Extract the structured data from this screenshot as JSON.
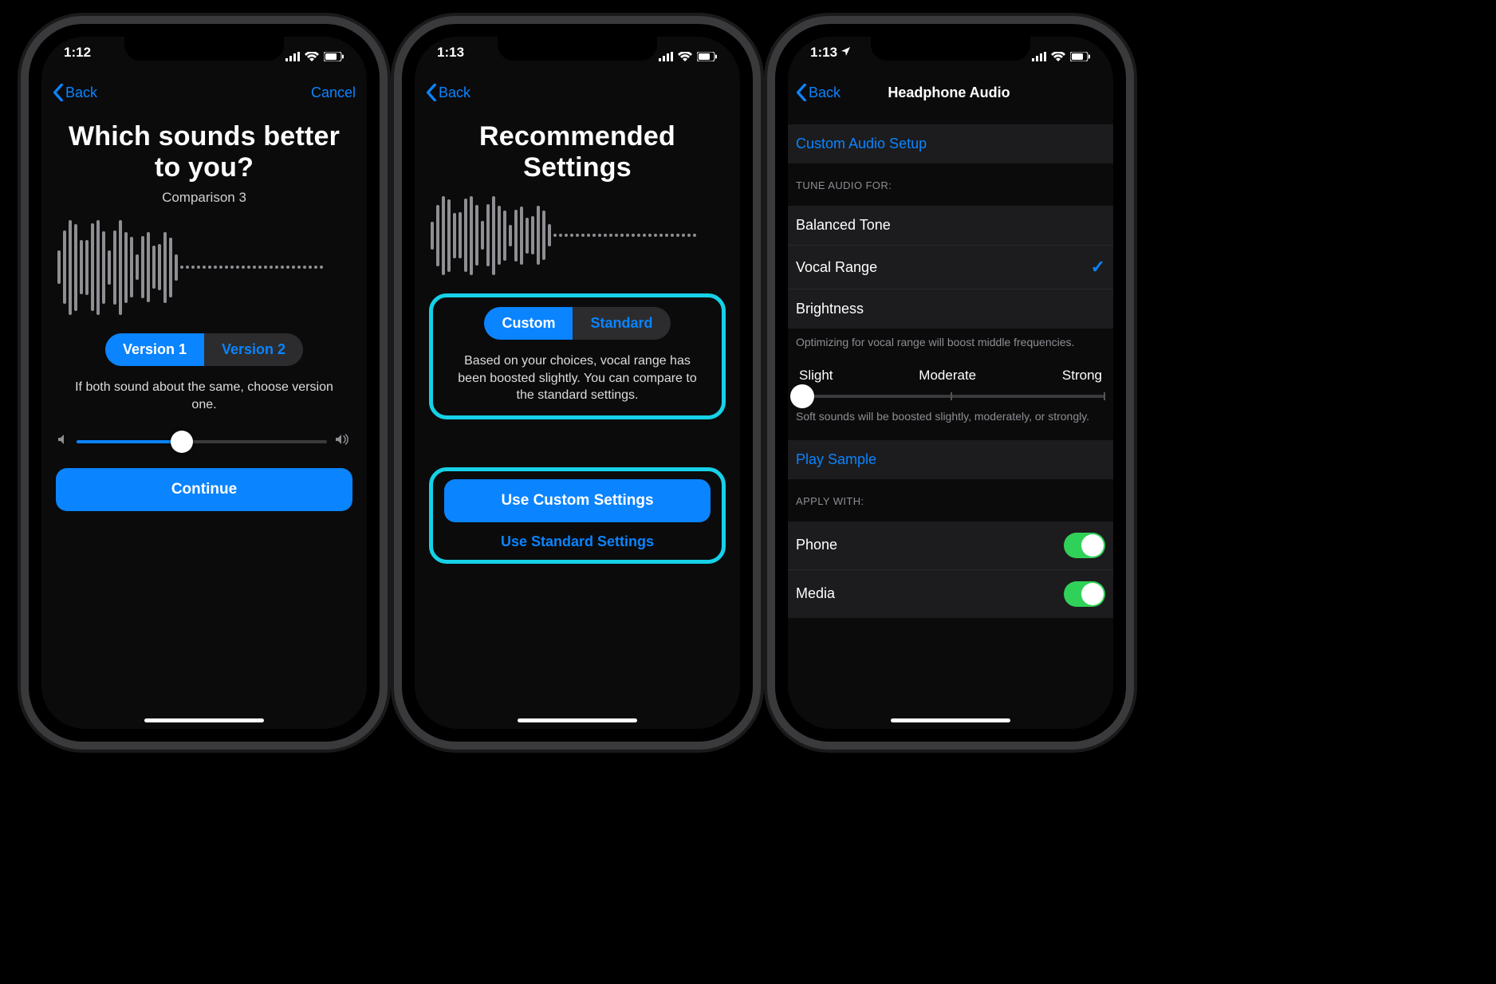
{
  "status": {
    "time1": "1:12",
    "time2": "1:13",
    "time3": "1:13"
  },
  "phone1": {
    "back": "Back",
    "cancel": "Cancel",
    "title": "Which sounds better to you?",
    "subtitle": "Comparison 3",
    "segments": {
      "a": "Version 1",
      "b": "Version 2",
      "selected": "a"
    },
    "instruction": "If both sound about the same, choose version one.",
    "volume_percent": 42,
    "continue": "Continue"
  },
  "phone2": {
    "back": "Back",
    "title": "Recommended Settings",
    "segments": {
      "a": "Custom",
      "b": "Standard",
      "selected": "a"
    },
    "description": "Based on your choices, vocal range has been boosted slightly. You can compare to the standard settings.",
    "primary": "Use Custom Settings",
    "secondary": "Use Standard Settings"
  },
  "phone3": {
    "back": "Back",
    "title": "Headphone Audio",
    "custom_setup": "Custom Audio Setup",
    "tune_header": "TUNE AUDIO FOR:",
    "options": {
      "balanced": "Balanced Tone",
      "vocal": "Vocal Range",
      "brightness": "Brightness"
    },
    "selected_option": "vocal",
    "tune_footer": "Optimizing for vocal range will boost middle frequencies.",
    "levels": {
      "slight": "Slight",
      "moderate": "Moderate",
      "strong": "Strong"
    },
    "level_value_percent": 2,
    "level_footer": "Soft sounds will be boosted slightly, moderately, or strongly.",
    "play_sample": "Play Sample",
    "apply_header": "APPLY WITH:",
    "apply": {
      "phone": "Phone",
      "media": "Media"
    },
    "toggles": {
      "phone": true,
      "media": true
    }
  }
}
